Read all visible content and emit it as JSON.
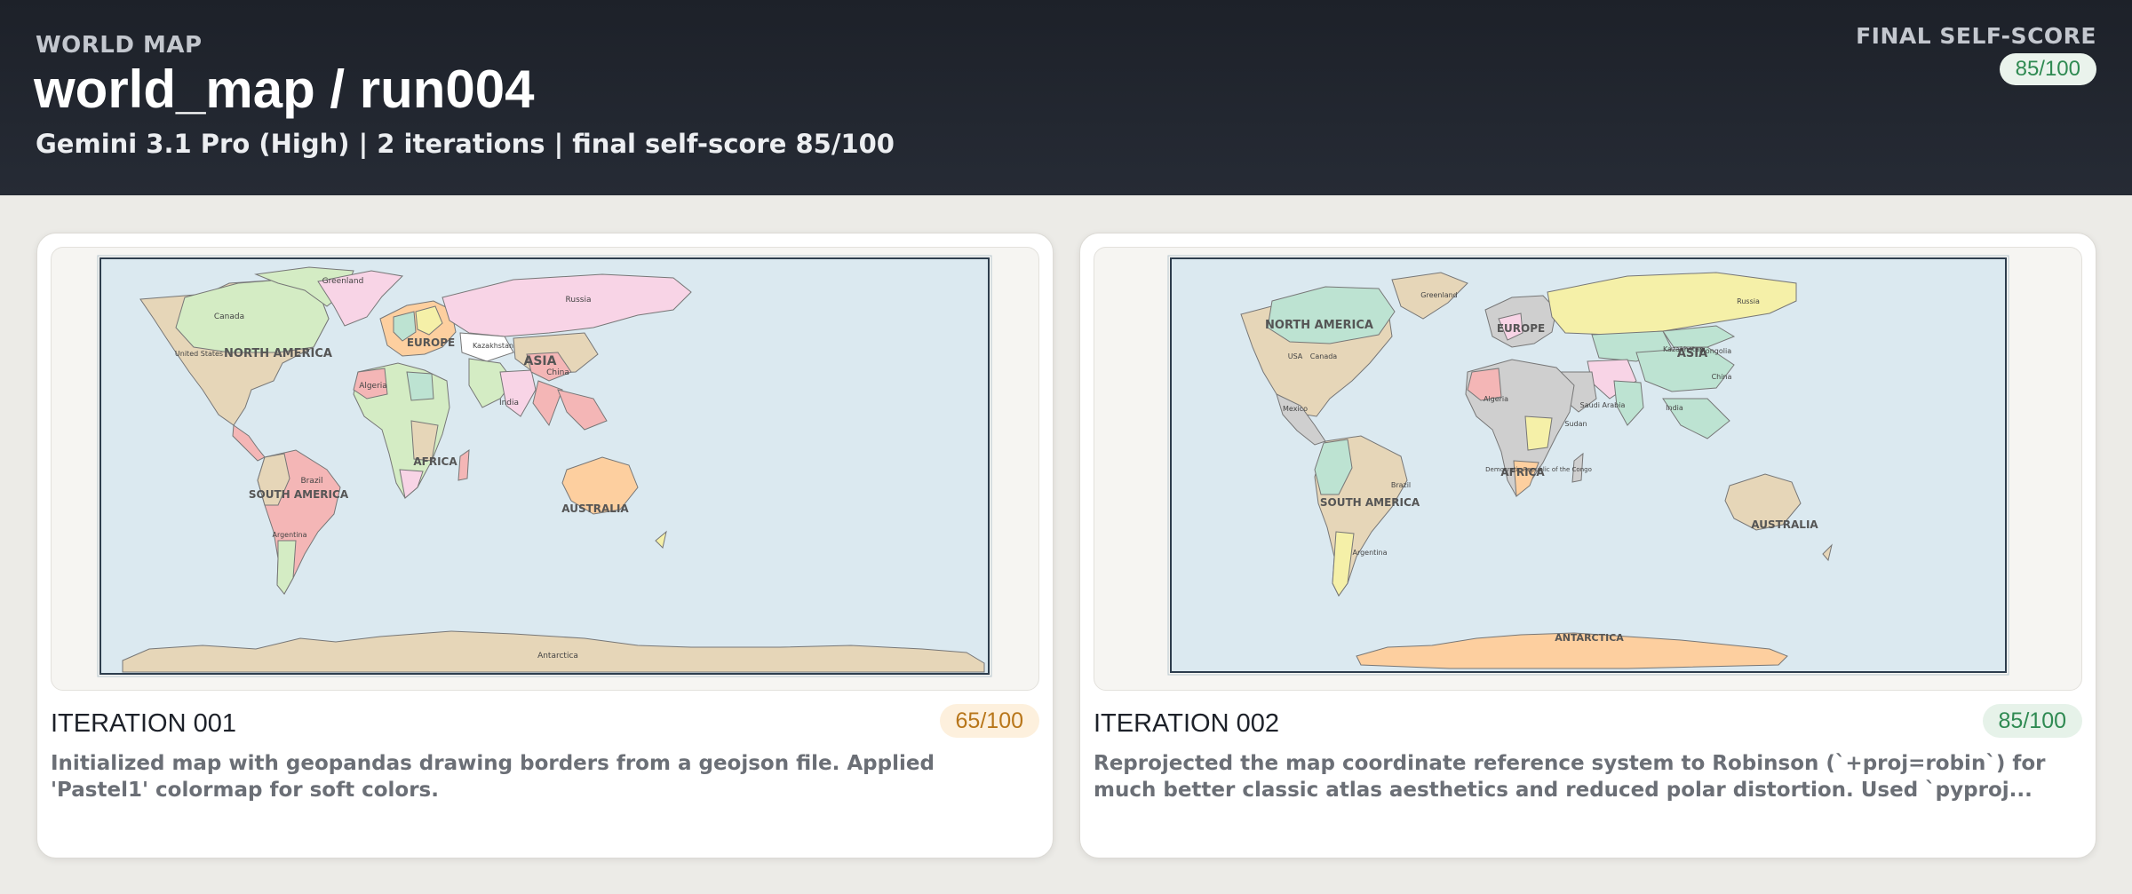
{
  "header": {
    "eyebrow": "WORLD MAP",
    "title": "world_map / run004",
    "subtitle": "Gemini 3.1 Pro (High)   |   2 iterations   |   final self-score 85/100",
    "final_label": "FINAL SELF-SCORE",
    "final_score": "85/100"
  },
  "iterations": [
    {
      "title": "ITERATION 001",
      "score": "65/100",
      "description": "Initialized map with geopandas drawing borders from a geojson file. Applied 'Pastel1' colormap for soft colors.",
      "map_labels": {
        "continents": [
          "NORTH AMERICA",
          "EUROPE",
          "ASIA",
          "AFRICA",
          "SOUTH AMERICA",
          "AUSTRALIA"
        ],
        "countries": [
          "Greenland",
          "Canada",
          "United States",
          "Russia",
          "Kazakhstan",
          "China",
          "India",
          "Algeria",
          "Brazil",
          "Argentina",
          "Antarctica"
        ]
      }
    },
    {
      "title": "ITERATION 002",
      "score": "85/100",
      "description": "Reprojected the map coordinate reference system to Robinson (`+proj=robin`) for much better classic atlas aesthetics and reduced polar distortion. Used `pyproj...",
      "map_labels": {
        "continents": [
          "NORTH AMERICA",
          "EUROPE",
          "ASIA",
          "AFRICA",
          "SOUTH AMERICA",
          "AUSTRALIA",
          "ANTARCTICA"
        ],
        "countries": [
          "Greenland",
          "Russia",
          "Canada",
          "USA",
          "Mexico",
          "Kazakhstan",
          "Mongolia",
          "China",
          "Algeria",
          "Saudi Arabia",
          "India",
          "Sudan",
          "Democratic Republic of the Congo",
          "Brazil",
          "Argentina"
        ]
      }
    }
  ],
  "colors": {
    "ocean": "#dbe9f0",
    "pastel_pink": "#f8d4e6",
    "pastel_green": "#d4ecc4",
    "pastel_tan": "#e6d6b8",
    "pastel_red": "#f4b6b6",
    "pastel_orange": "#fdcf9f",
    "pastel_teal": "#bde3d2",
    "pastel_yellow": "#f5f0a8",
    "pastel_grey": "#cfcfcf"
  }
}
